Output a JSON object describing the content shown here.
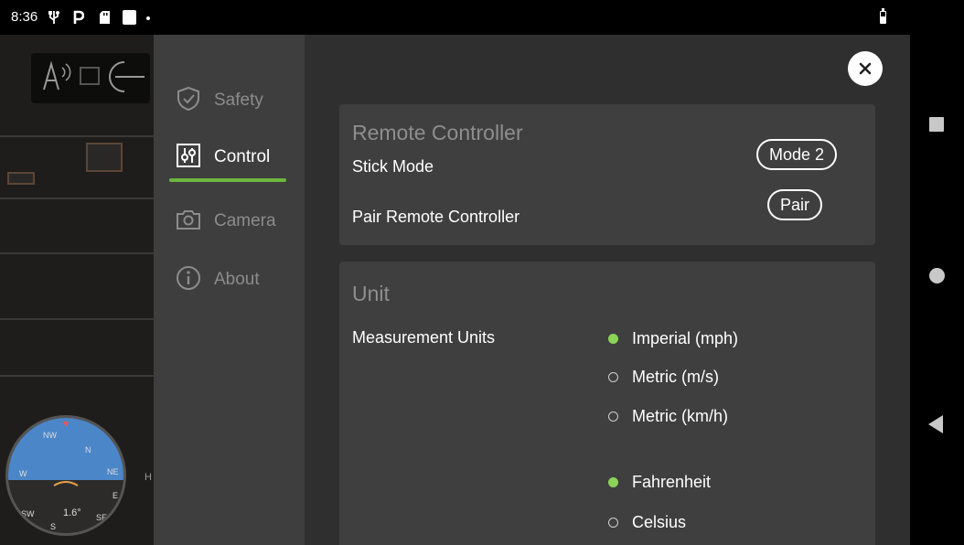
{
  "status_bar": {
    "time": "8:36",
    "icons": [
      "usb-icon",
      "p-icon",
      "sd-card-icon",
      "square-icon",
      "dot-icon",
      "battery-icon"
    ]
  },
  "overlay": {
    "compass_labels": [
      "NW",
      "N",
      "NE",
      "W",
      "E",
      "SW",
      "S",
      "SE"
    ],
    "compass_value": "1.6°",
    "side_marker": "H"
  },
  "sidebar": {
    "items": [
      {
        "label": "Safety",
        "icon": "shield-check-icon",
        "active": false
      },
      {
        "label": "Control",
        "icon": "sliders-icon",
        "active": true
      },
      {
        "label": "Camera",
        "icon": "camera-icon",
        "active": false
      },
      {
        "label": "About",
        "icon": "info-icon",
        "active": false
      }
    ]
  },
  "main": {
    "close_icon": "close-icon",
    "remote_controller": {
      "title": "Remote Controller",
      "stick_mode_label": "Stick Mode",
      "stick_mode_value": "Mode 2",
      "pair_label": "Pair Remote Controller",
      "pair_button": "Pair"
    },
    "unit": {
      "title": "Unit",
      "measurement_label": "Measurement Units",
      "speed_options": [
        {
          "label": "Imperial (mph)",
          "selected": true
        },
        {
          "label": "Metric (m/s)",
          "selected": false
        },
        {
          "label": "Metric (km/h)",
          "selected": false
        }
      ],
      "temperature_options": [
        {
          "label": "Fahrenheit",
          "selected": true
        },
        {
          "label": "Celsius",
          "selected": false
        }
      ]
    }
  },
  "colors": {
    "accent_green": "#6bb63e",
    "radio_green": "#8cd35a",
    "sky_blue": "#4b86c8"
  }
}
